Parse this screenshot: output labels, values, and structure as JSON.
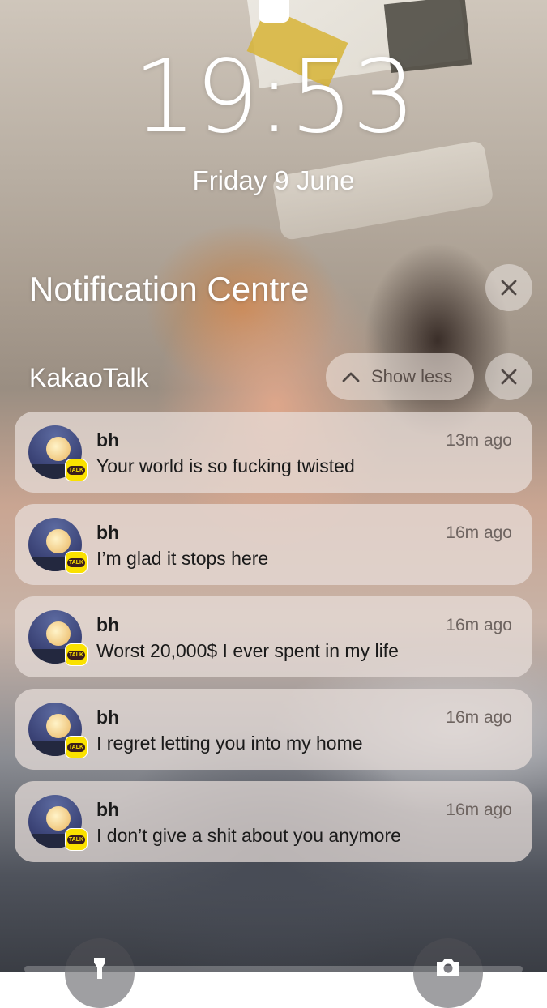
{
  "lock_screen": {
    "time": "19:53",
    "date": "Friday 9 June"
  },
  "notification_centre": {
    "title": "Notification Centre",
    "clear_icon": "xmark-icon"
  },
  "group": {
    "app_name": "KakaoTalk",
    "show_less_label": "Show less",
    "collapse_icon": "chevron-up-icon",
    "clear_icon": "xmark-icon"
  },
  "notifications": [
    {
      "sender": "bh",
      "time": "13m ago",
      "message": "Your world is so fucking twisted"
    },
    {
      "sender": "bh",
      "time": "16m ago",
      "message": "I’m glad it stops here"
    },
    {
      "sender": "bh",
      "time": "16m ago",
      "message": "Worst 20,000$ I ever spent in my life"
    },
    {
      "sender": "bh",
      "time": "16m ago",
      "message": "I regret letting you into my home"
    },
    {
      "sender": "bh",
      "time": "16m ago",
      "message": "I don’t give a shit about you anymore"
    }
  ],
  "app_badge": {
    "label": "TALK",
    "color": "#FAE100"
  },
  "quick_actions": {
    "left_icon": "flashlight-icon",
    "right_icon": "camera-icon"
  }
}
